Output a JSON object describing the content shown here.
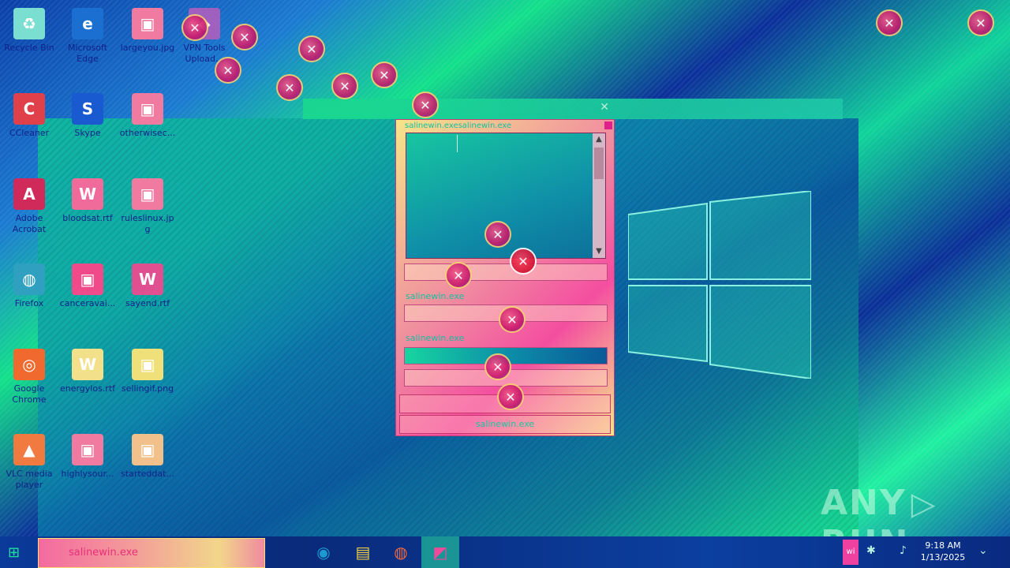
{
  "desktop": {
    "icons": [
      {
        "label": "Recycle Bin",
        "icon": "recycle-bin-icon",
        "color": "#7adfd0"
      },
      {
        "label": "Microsoft Edge",
        "icon": "edge-icon",
        "color": "#1a6fd0"
      },
      {
        "label": "largeyou.jpg",
        "icon": "image-file-icon",
        "color": "#f07aa0"
      },
      {
        "label": "VPN Tools Upload...",
        "icon": "app-icon",
        "color": "#a060c0"
      },
      {
        "label": "CCleaner",
        "icon": "ccleaner-icon",
        "color": "#e0404a"
      },
      {
        "label": "Skype",
        "icon": "skype-icon",
        "color": "#1a5ad0"
      },
      {
        "label": "otherwisec...",
        "icon": "image-file-icon",
        "color": "#f07aa0"
      },
      {
        "label": "Adobe Acrobat",
        "icon": "acrobat-icon",
        "color": "#d02a5a"
      },
      {
        "label": "bloodsat.rtf",
        "icon": "word-doc-icon",
        "color": "#f06a9a"
      },
      {
        "label": "ruleslinux.jpg",
        "icon": "image-file-icon",
        "color": "#f07aa0"
      },
      {
        "label": "Firefox",
        "icon": "firefox-icon",
        "color": "#30a0c0"
      },
      {
        "label": "canceravai...",
        "icon": "image-file-icon",
        "color": "#f04a8a"
      },
      {
        "label": "sayend.rtf",
        "icon": "word-doc-icon",
        "color": "#e05090"
      },
      {
        "label": "Google Chrome",
        "icon": "chrome-icon",
        "color": "#f06a30"
      },
      {
        "label": "energylos.rtf",
        "icon": "word-doc-icon",
        "color": "#f2e08a"
      },
      {
        "label": "sellingif.png",
        "icon": "image-file-icon",
        "color": "#f0e07a"
      },
      {
        "label": "VLC media player",
        "icon": "vlc-icon",
        "color": "#f07a40"
      },
      {
        "label": "highlysour...",
        "icon": "image-file-icon",
        "color": "#f07aa0"
      },
      {
        "label": "starteddat...",
        "icon": "image-file-icon",
        "color": "#f2c08a"
      }
    ]
  },
  "dialog": {
    "title": "salinewin.exesalinewin.exe",
    "group_label_1": "salinewin.exe",
    "group_label_2": "salinewin.exe",
    "bottom_button": "salinewin.exe"
  },
  "watermark": {
    "left": "ANY",
    "right": "RUN"
  },
  "taskbar": {
    "search_text": "salinewin.exe",
    "pinned": [
      "edge-icon",
      "file-explorer-icon",
      "firefox-icon",
      "salinewin-icon"
    ],
    "tray_pink_text": "wi",
    "clock_time": "9:18 AM",
    "clock_date": "1/13/2025"
  }
}
